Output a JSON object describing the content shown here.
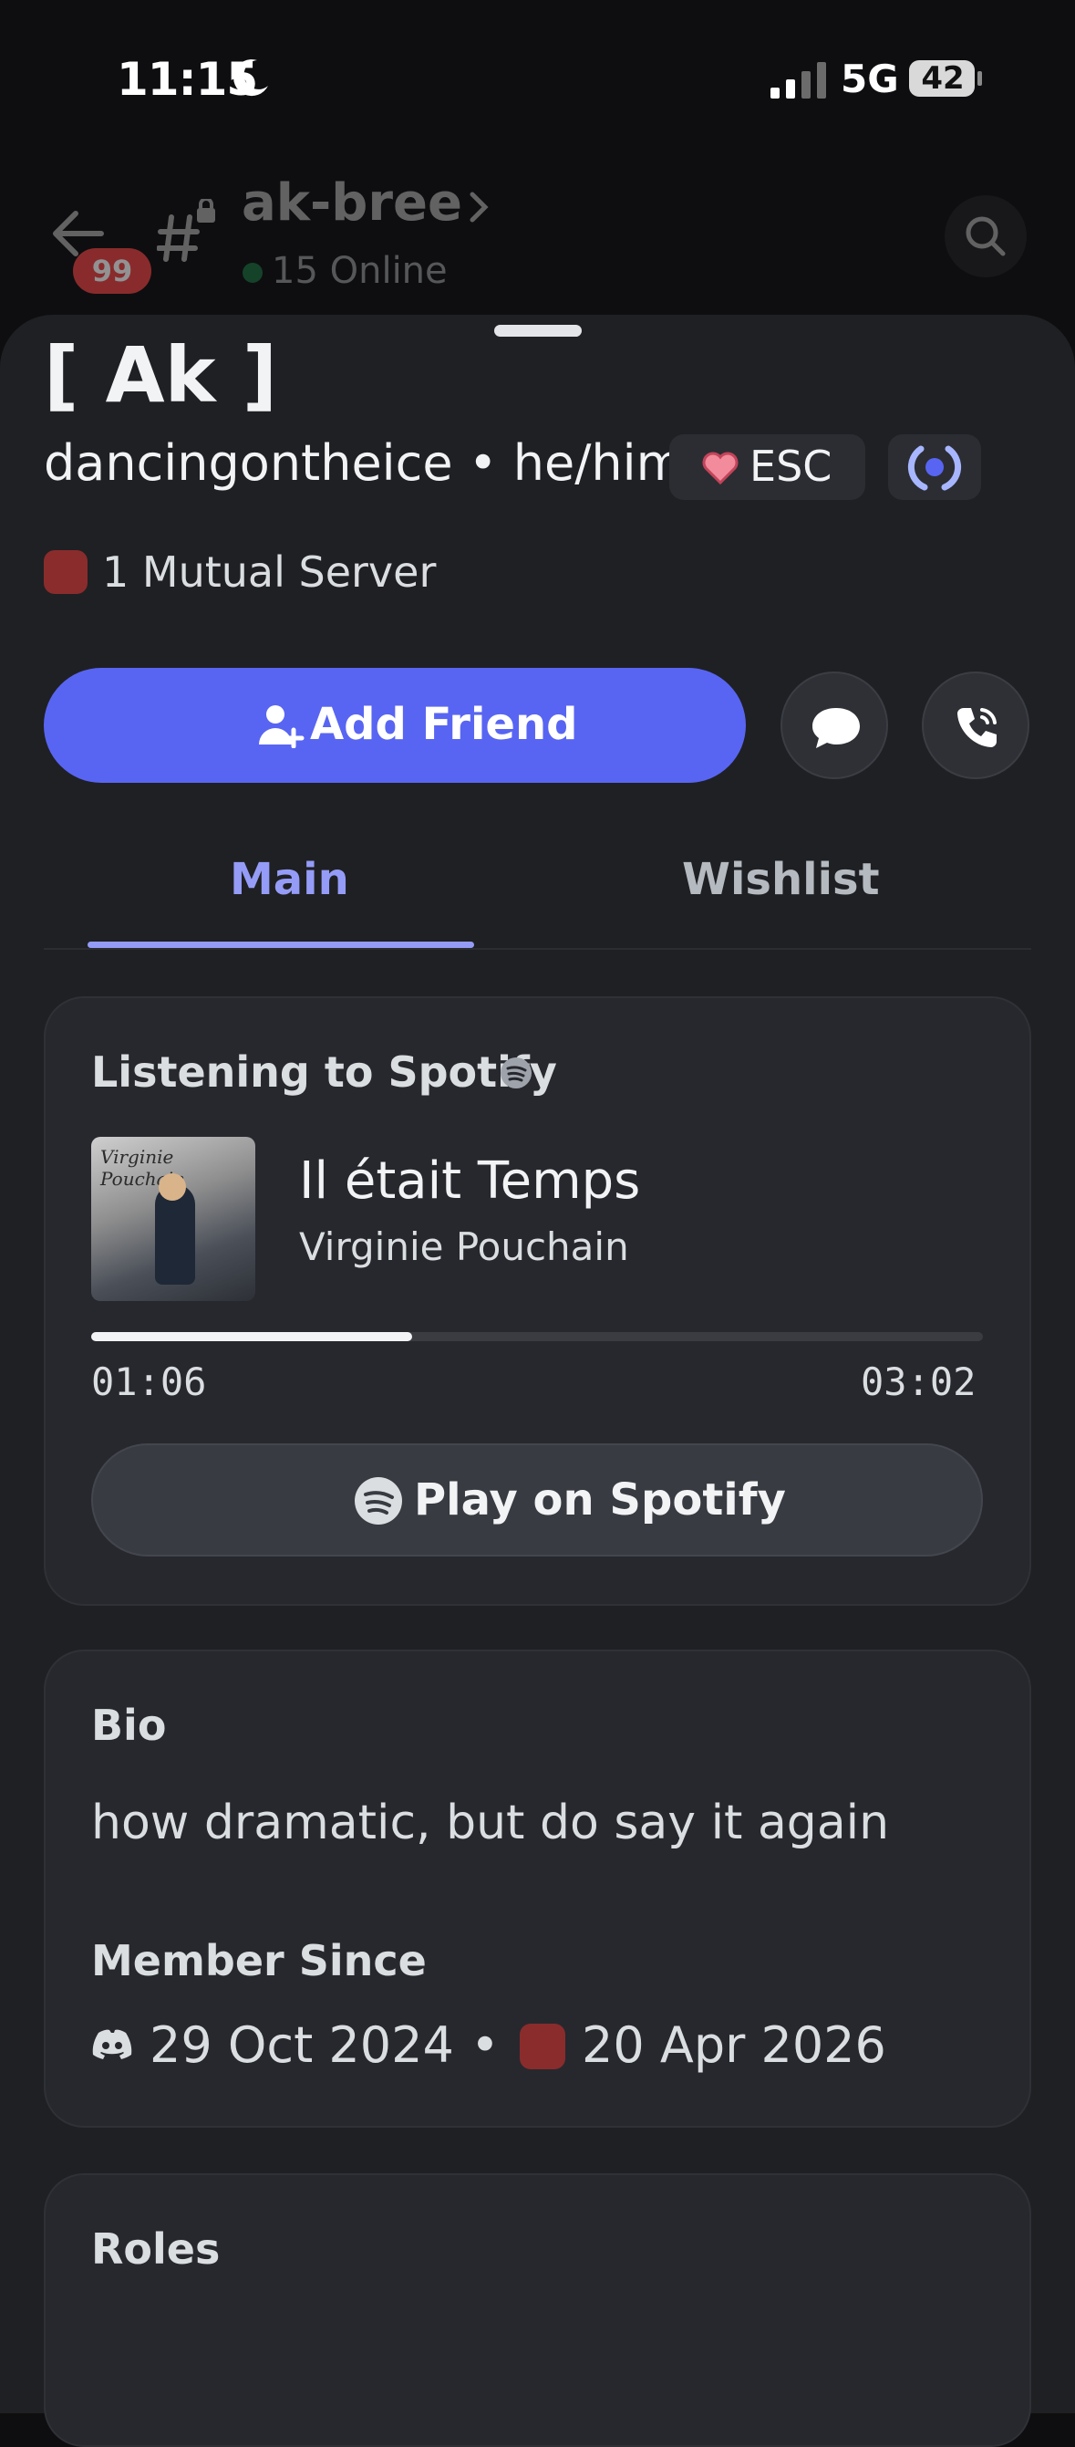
{
  "status_bar": {
    "time": "11:15",
    "network": "5G",
    "battery": "42"
  },
  "channel_header": {
    "unread_count": "99",
    "name": "ak-bree",
    "online": "15 Online"
  },
  "profile": {
    "display_name": "[ Ak ]",
    "username_line": "dancingontheice • he/him",
    "tag": "ESC",
    "mutual_servers": "1 Mutual Server"
  },
  "actions": {
    "add_friend": "Add Friend"
  },
  "tabs": {
    "main": "Main",
    "wishlist": "Wishlist",
    "active": "Main"
  },
  "spotify": {
    "heading": "Listening to Spotify",
    "album_text": "Virginie Pouchain",
    "track": "Il était Temps",
    "artist": "Virginie Pouchain",
    "elapsed": "01:06",
    "total": "03:02",
    "progress": 0.36,
    "play_label": "Play on Spotify"
  },
  "bio": {
    "heading": "Bio",
    "text": "how dramatic, but do say it again",
    "member_since_heading": "Member Since",
    "discord_date": "29 Oct 2024",
    "separator": "•",
    "server_date": "20 Apr 2026"
  },
  "roles": {
    "heading": "Roles"
  },
  "colors": {
    "accent": "#5865f2",
    "tab_active": "#949cf7",
    "online": "#23a55a",
    "badge": "#ef4444"
  }
}
